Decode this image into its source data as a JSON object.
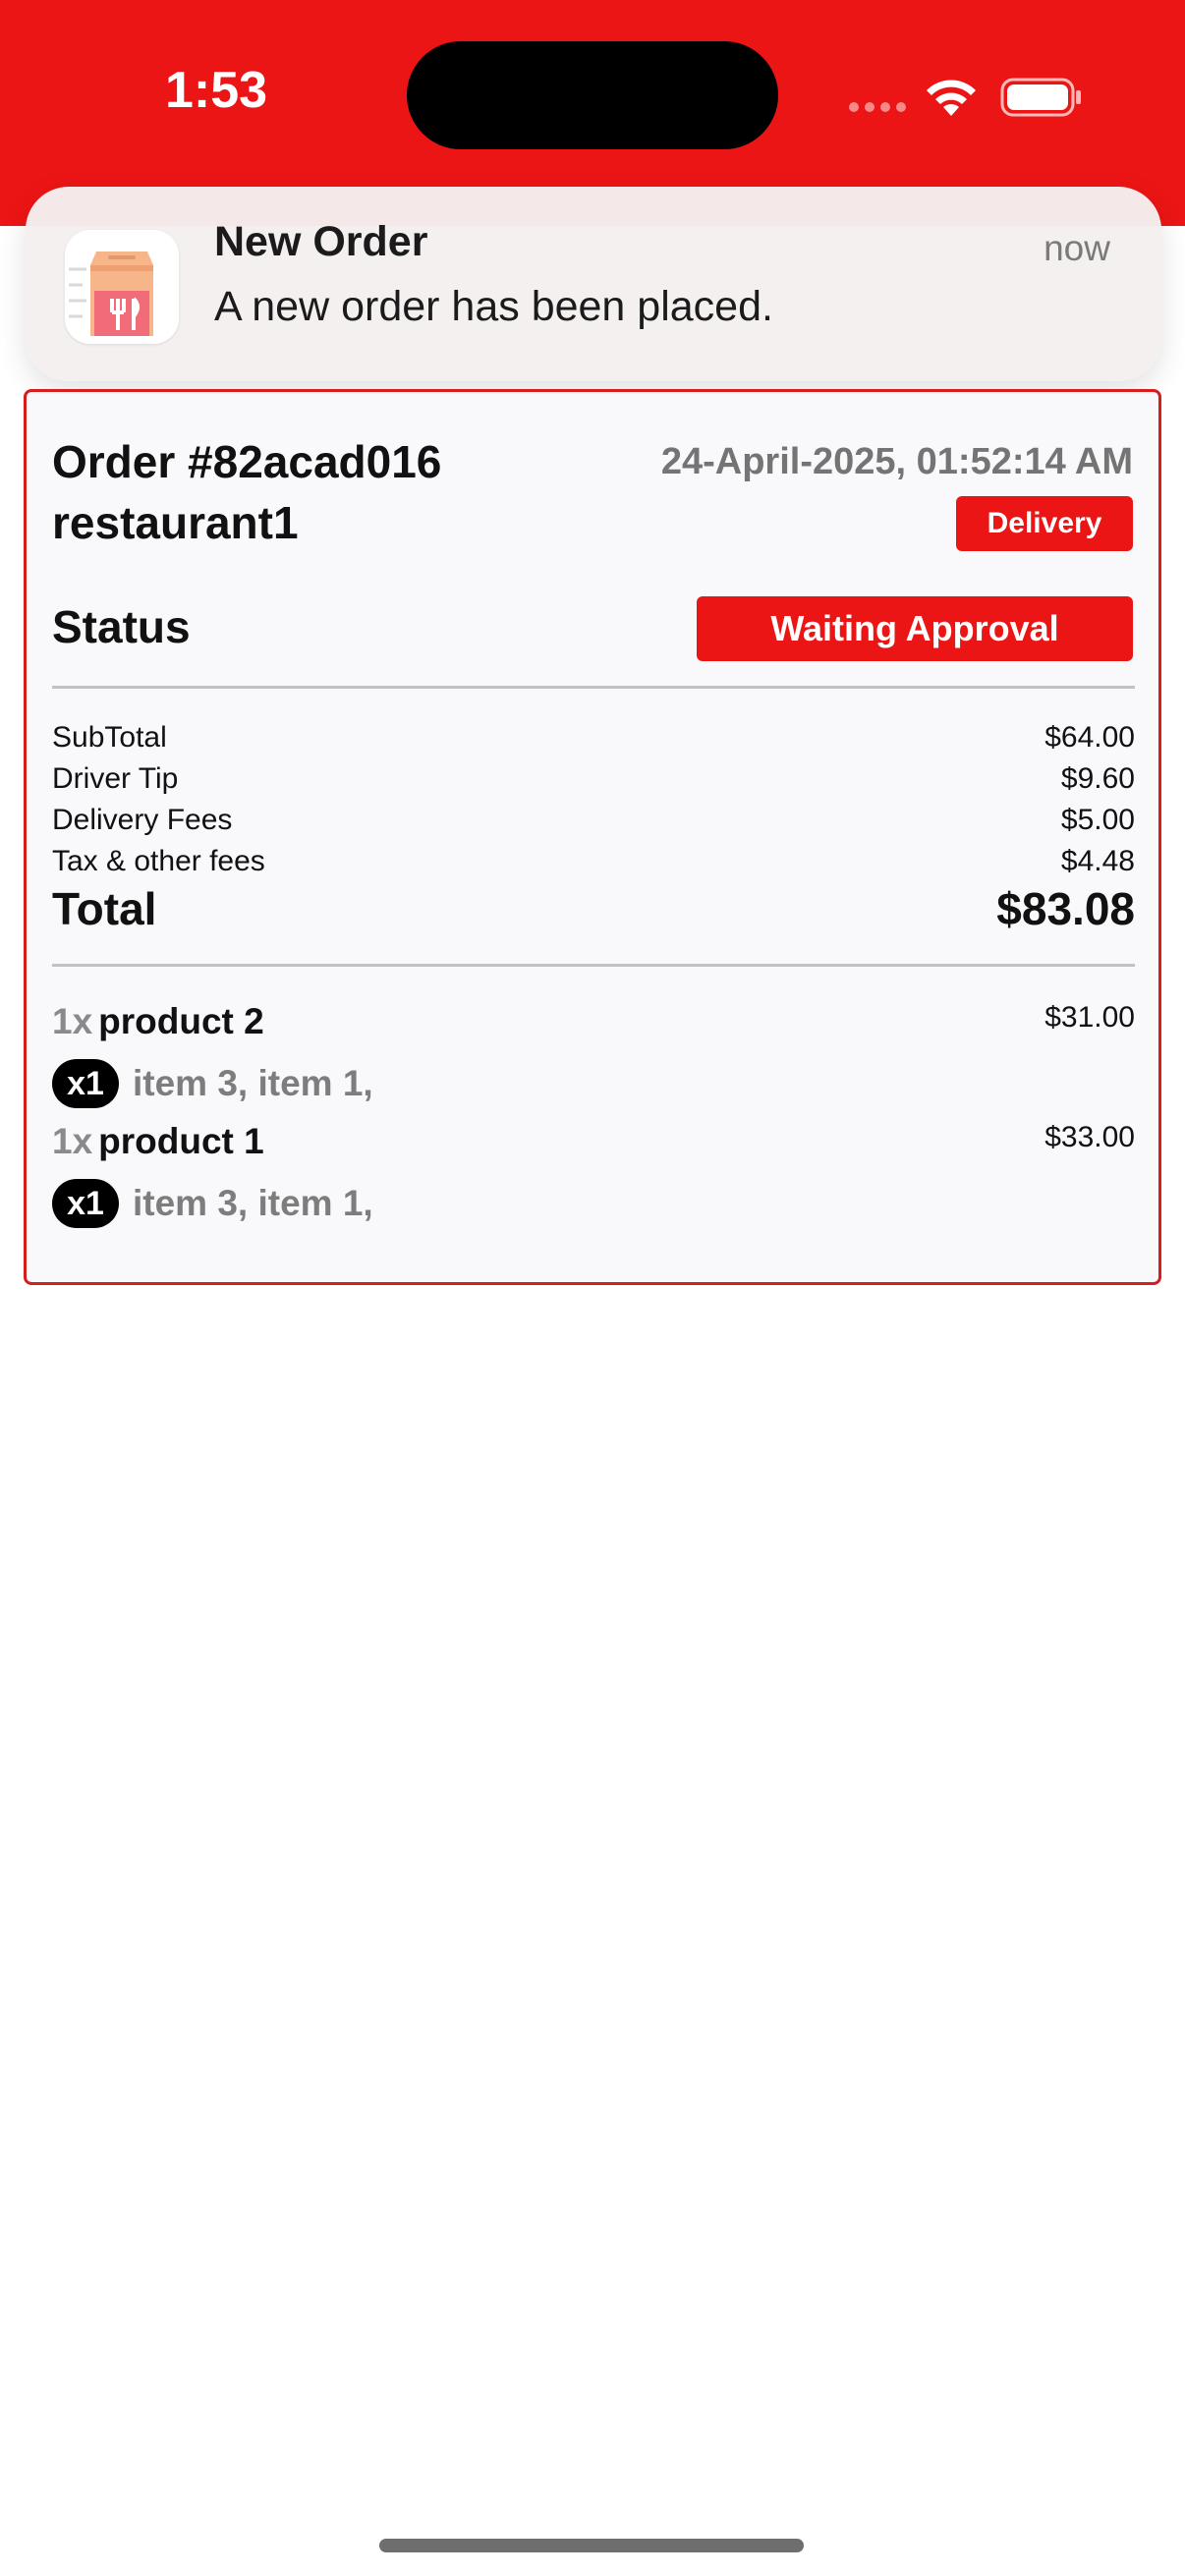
{
  "status_bar": {
    "time": "1:53"
  },
  "notification": {
    "icon": "takeout-bag-icon",
    "title": "New Order",
    "time": "now",
    "body": "A new order has been placed."
  },
  "order": {
    "number": "Order #82acad016",
    "restaurant": "restaurant1",
    "date": "24-April-2025, 01:52:14 AM",
    "type": "Delivery",
    "status_label": "Status",
    "status_value": "Waiting Approval",
    "fees": [
      {
        "label": "SubTotal",
        "value": "$64.00"
      },
      {
        "label": "Driver Tip",
        "value": "$9.60"
      },
      {
        "label": "Delivery Fees",
        "value": "$5.00"
      },
      {
        "label": "Tax & other fees",
        "value": "$4.48"
      }
    ],
    "total_label": "Total",
    "total_value": "$83.08",
    "products": [
      {
        "qty": "1x",
        "name": "product 2",
        "price": "$31.00",
        "option_qty": "x1",
        "option_items": "item 3, item 1,"
      },
      {
        "qty": "1x",
        "name": "product 1",
        "price": "$33.00",
        "option_qty": "x1",
        "option_items": "item 3, item 1,"
      }
    ]
  },
  "colors": {
    "accent": "#ec1515",
    "card_border": "#d81d1d"
  }
}
